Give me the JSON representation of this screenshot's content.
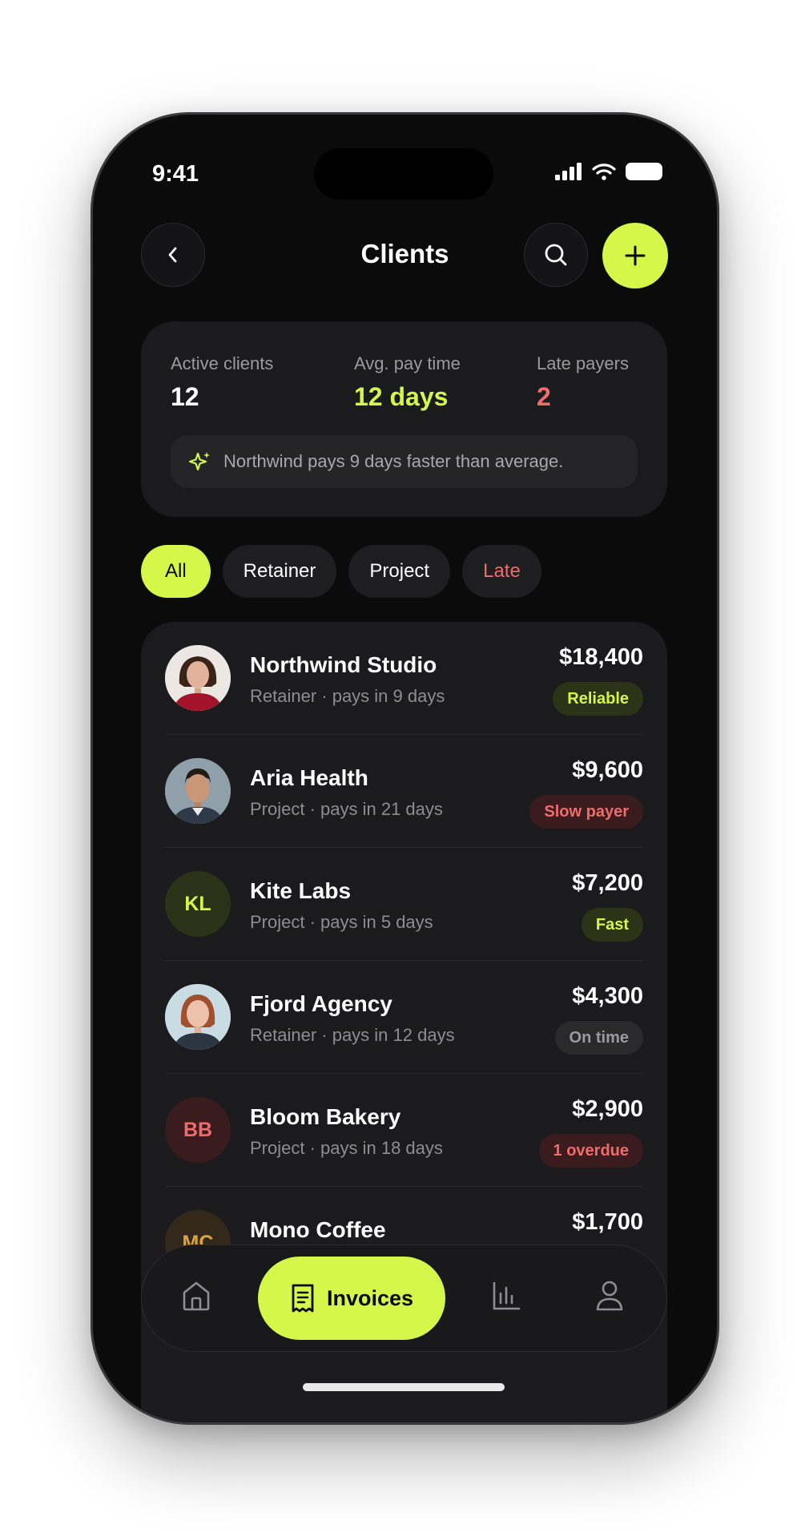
{
  "status_bar": {
    "time": "9:41"
  },
  "header": {
    "title": "Clients"
  },
  "stats": [
    {
      "label": "Active clients",
      "value": "12",
      "color": "#ffffff"
    },
    {
      "label": "Avg. pay time",
      "value": "12 days",
      "color": "#d4f74a"
    },
    {
      "label": "Late payers",
      "value": "2",
      "color": "#f06b6b"
    }
  ],
  "insight": {
    "text": "Northwind pays 9 days faster than average.",
    "icon": "sparkle-icon"
  },
  "filters": [
    "All",
    "Retainer",
    "Project",
    "Late"
  ],
  "clients": [
    {
      "name": "Northwind Studio",
      "meta": "Retainer · pays in 9 days",
      "amount": "$18,400",
      "badge": "Reliable",
      "avatar": "photo",
      "initials": ""
    },
    {
      "name": "Aria Health",
      "meta": "Project · pays in 21 days",
      "amount": "$9,600",
      "badge": "Slow payer",
      "avatar": "photo",
      "initials": ""
    },
    {
      "name": "Kite Labs",
      "meta": "Project · pays in 5 days",
      "amount": "$7,200",
      "badge": "Fast",
      "avatar": "initials",
      "initials": "KL"
    },
    {
      "name": "Fjord Agency",
      "meta": "Retainer · pays in 12 days",
      "amount": "$4,300",
      "badge": "On time",
      "avatar": "photo",
      "initials": ""
    },
    {
      "name": "Bloom Bakery",
      "meta": "Project · pays in 18 days",
      "amount": "$2,900",
      "badge": "1 overdue",
      "avatar": "initials",
      "initials": "BB"
    },
    {
      "name": "Mono Coffee",
      "meta": "",
      "amount": "$1,700",
      "badge": "",
      "avatar": "initials",
      "initials": "MC"
    }
  ],
  "nav": {
    "invoices_label": "Invoices"
  },
  "colors": {
    "accent": "#d4f74a",
    "danger": "#f06b6b",
    "background": "#0b0b0c",
    "card": "#1b1b1d"
  }
}
